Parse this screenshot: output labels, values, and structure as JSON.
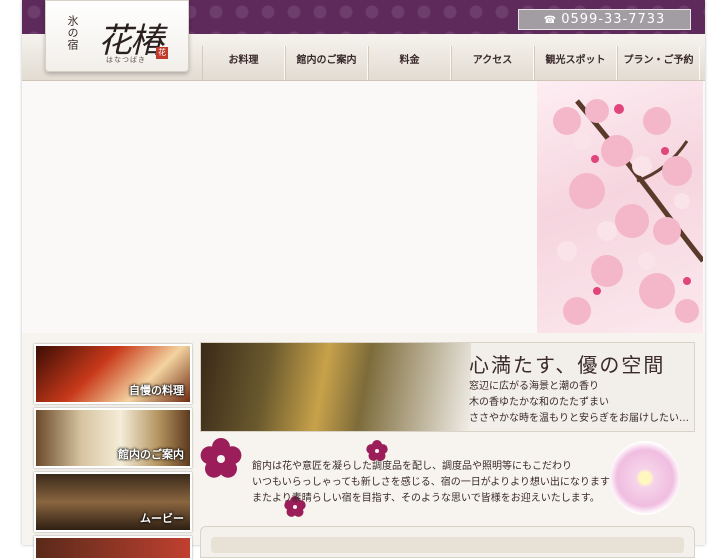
{
  "header": {
    "logo": {
      "small_text": "氷の宿",
      "main_text": "花椿",
      "sub_text": "はなつばき",
      "stamp": "花"
    },
    "phone": {
      "icon": "telephone-icon",
      "number": "0599-33-7733"
    }
  },
  "nav": {
    "items": [
      "お料理",
      "館内のご案内",
      "料金",
      "アクセス",
      "観光スポット",
      "プラン・ご予約"
    ]
  },
  "side_banners": [
    {
      "label": "自慢の料理"
    },
    {
      "label": "館内のご案内"
    },
    {
      "label": "ムービー"
    },
    {
      "label": ""
    }
  ],
  "feature": {
    "title": "心満たす、優の空間",
    "lines": [
      "窓辺に広がる海景と潮の香り",
      "木の香ゆたかな和のたたずまい",
      "ささやかな時を温もりと安らぎをお届けしたい…"
    ]
  },
  "intro": {
    "lines": [
      "館内は花や意匠を凝らした調度品を配し、調度品や照明等にもこだわり",
      "いつもいらっしゃっても新しさを感じる、宿の一日がよりより想い出になりますよう",
      "またより素晴らしい宿を目指す、そのような思いで皆様をお迎えいたします。"
    ]
  },
  "colors": {
    "header_purple": "#5e2a5c",
    "flower_magenta": "#9b1e5a",
    "page_bg": "#f7f4ef"
  }
}
